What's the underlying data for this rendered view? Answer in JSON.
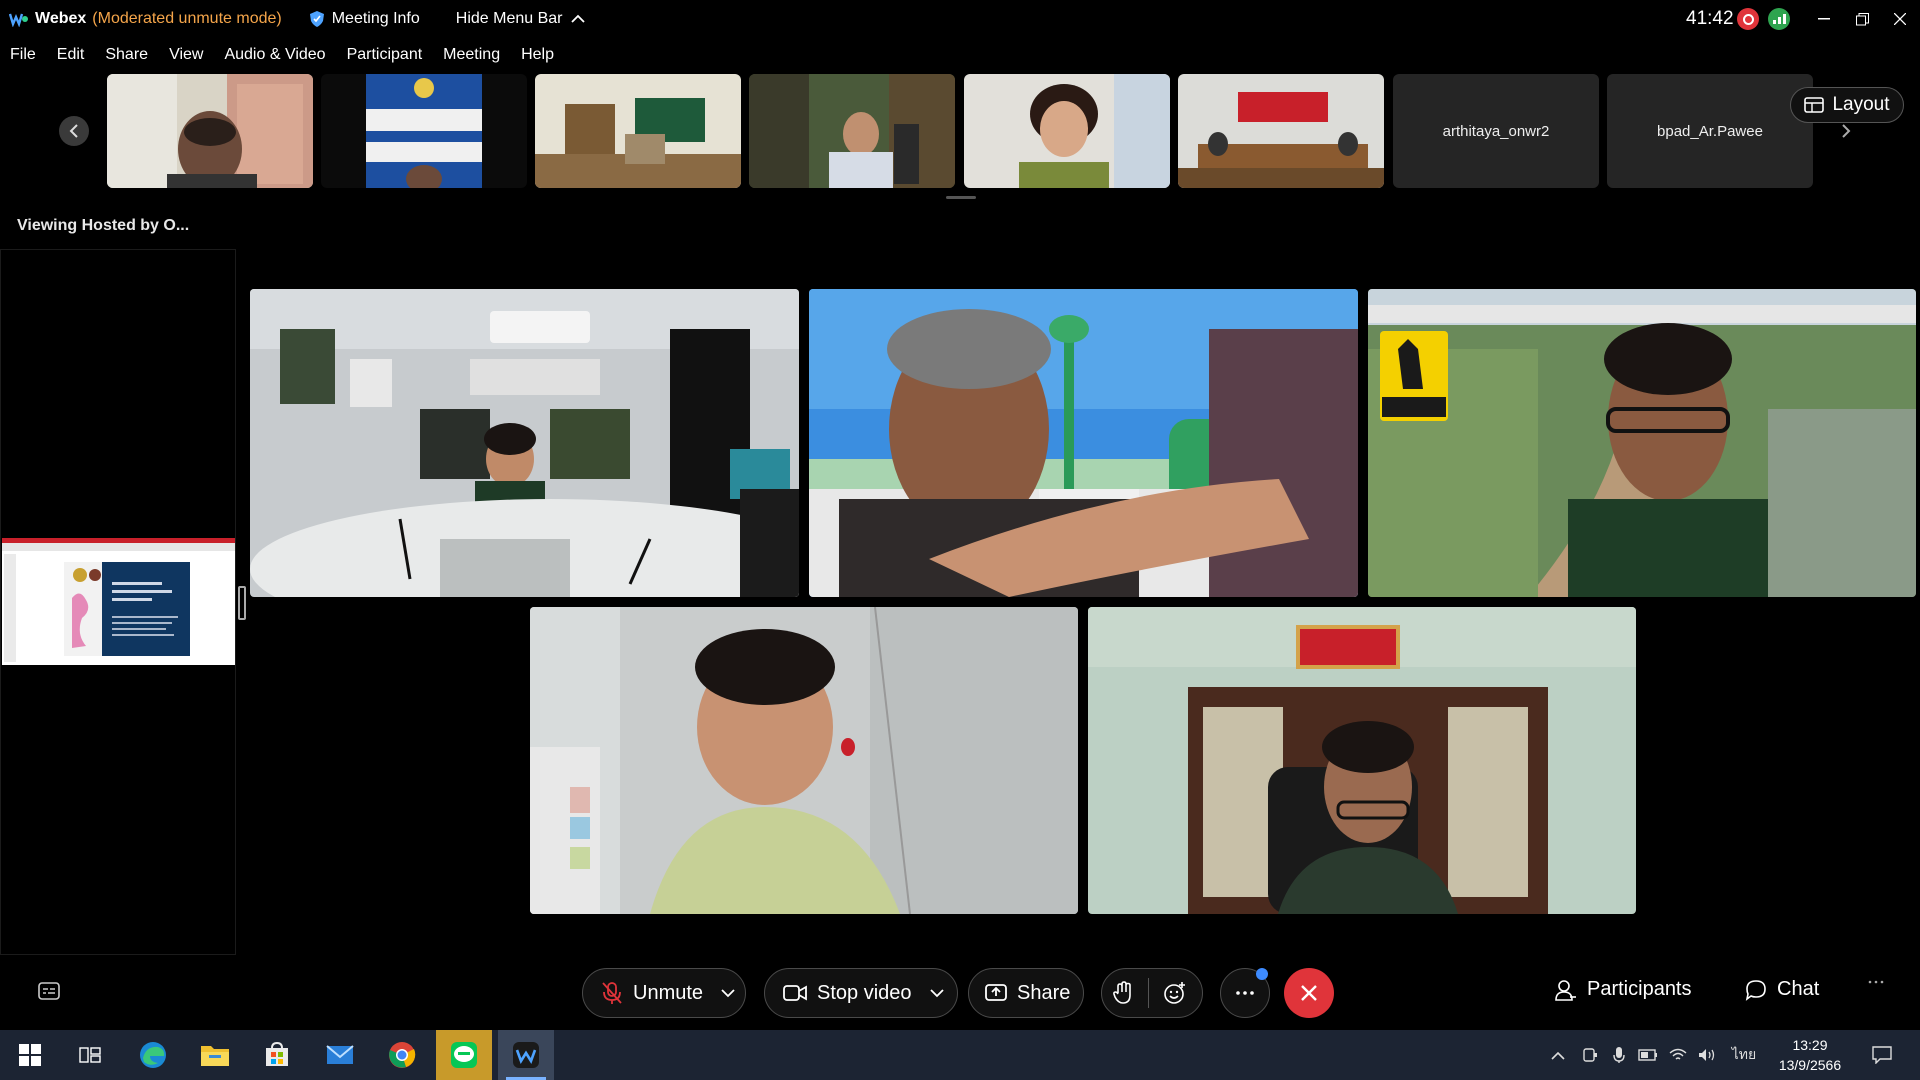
{
  "titlebar": {
    "app_name": "Webex",
    "mode": "(Moderated unmute mode)",
    "meeting_info": "Meeting Info",
    "hide_menu": "Hide Menu Bar",
    "timer": "41:42"
  },
  "menu": {
    "items": [
      "File",
      "Edit",
      "Share",
      "View",
      "Audio & Video",
      "Participant",
      "Meeting",
      "Help"
    ]
  },
  "filmstrip": {
    "name_tiles": [
      "arthitaya_onwr2",
      "bpad_Ar.Pawee"
    ],
    "layout_label": "Layout"
  },
  "share": {
    "viewing_label": "Viewing Hosted by O..."
  },
  "controls": {
    "unmute_label": "Unmute",
    "stop_video_label": "Stop video",
    "share_label": "Share",
    "participants_label": "Participants",
    "chat_label": "Chat"
  },
  "taskbar": {
    "language": "ไทย",
    "time": "13:29",
    "date": "13/9/2566"
  },
  "colors": {
    "mode_text": "#f5a54a",
    "end_button": "#e0343a",
    "record_dot": "#e0343a",
    "network_dot": "#2ea44f",
    "taskbar": "#1c2433"
  }
}
